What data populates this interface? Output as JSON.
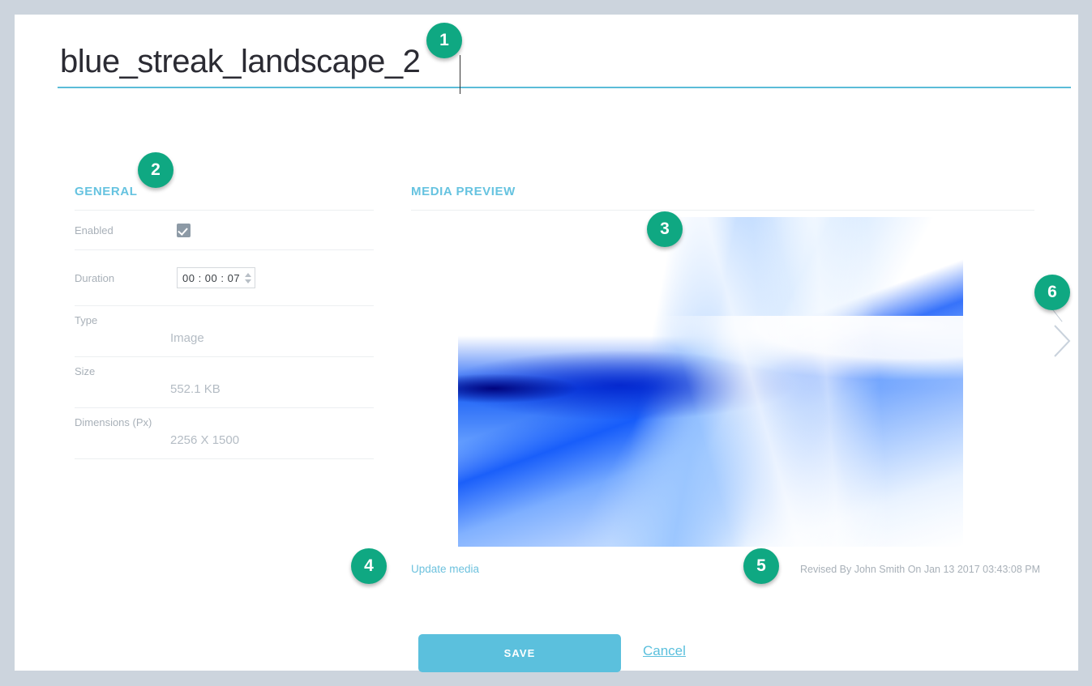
{
  "window": {
    "background_color": "#ccd4dd",
    "card_color": "#ffffff"
  },
  "title": {
    "value": "blue_streak_landscape_2",
    "placeholder": "Enter media name",
    "underline_color": "#5bbcd8"
  },
  "general": {
    "heading": "GENERAL",
    "rows": [
      {
        "label": "Enabled",
        "value": "",
        "control": "checkbox",
        "checked": true
      },
      {
        "label": "Duration",
        "value": "00 : 00 : 07",
        "control": "spinner"
      },
      {
        "label": "Type",
        "value": "Image",
        "control": "readonly"
      },
      {
        "label": "Size",
        "value": "552.1 KB",
        "control": "readonly"
      },
      {
        "label": "Dimensions (Px)",
        "value": "2256 X 1500",
        "control": "readonly"
      }
    ]
  },
  "media": {
    "heading": "MEDIA PREVIEW",
    "update_link": "Update media",
    "revised": "Revised By John Smith On Jan 13 2017 03:43:08 PM",
    "image_alt": "blue streak abstract landscape"
  },
  "footer": {
    "save_label": "SAVE",
    "cancel_label": "Cancel",
    "save_color": "#5bc0dd"
  },
  "navigation": {
    "next_icon": "chevron-right-icon"
  },
  "callouts": [
    {
      "number": "1",
      "target": "title-field"
    },
    {
      "number": "2",
      "target": "general-section"
    },
    {
      "number": "3",
      "target": "media-preview-image"
    },
    {
      "number": "4",
      "target": "update-media-link"
    },
    {
      "number": "5",
      "target": "revised-info"
    },
    {
      "number": "6",
      "target": "next-arrow"
    }
  ],
  "accent_colors": {
    "callout": "#0fa882",
    "section_heading": "#66c3e0",
    "link": "#6ec2de"
  }
}
